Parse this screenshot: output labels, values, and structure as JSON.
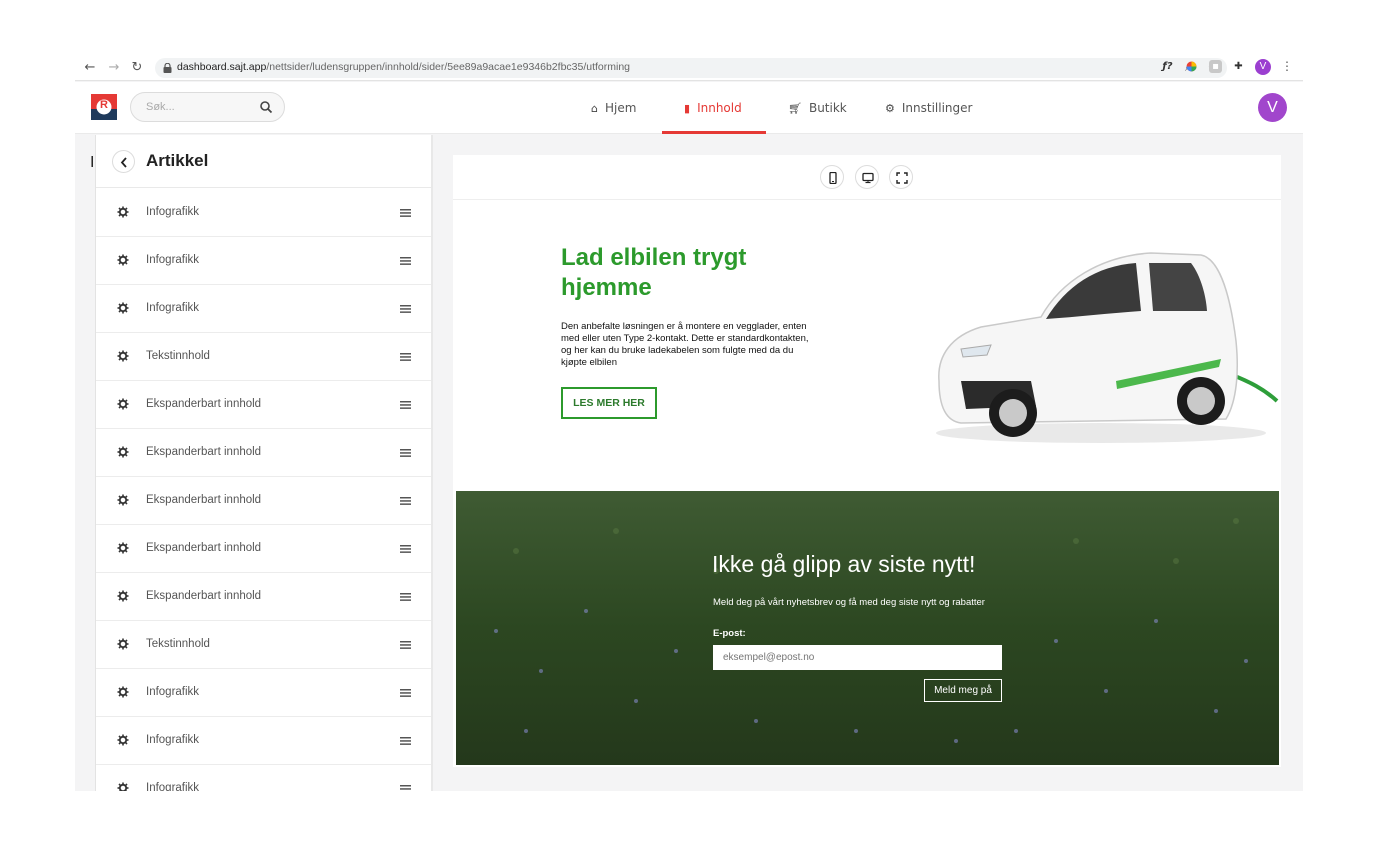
{
  "browser": {
    "url_domain": "dashboard.sajt.app",
    "url_path": "/nettsider/ludensgruppen/innhold/sider/5ee89a9acae1e9346b2fbc35/utforming",
    "profile_initial": "V",
    "extension_icons": [
      "zoom-icon",
      "star-icon",
      "function-icon",
      "color-wheel-icon",
      "extension-box-icon",
      "puzzle-icon"
    ]
  },
  "app": {
    "logo_letter": "R",
    "search_placeholder": "Søk...",
    "nav": [
      {
        "label": "Hjem",
        "icon": "home-icon"
      },
      {
        "label": "Innhold",
        "icon": "pages-icon",
        "active": true
      },
      {
        "label": "Butikk",
        "icon": "cart-icon"
      },
      {
        "label": "Innstillinger",
        "icon": "gear-icon"
      }
    ],
    "avatar_initial": "V",
    "accent_color": "#e53935",
    "avatar_color": "#a146cc"
  },
  "sidebar": {
    "edge_letter": "I",
    "title": "Artikkel",
    "items": [
      {
        "label": "Infografikk"
      },
      {
        "label": "Infografikk"
      },
      {
        "label": "Infografikk"
      },
      {
        "label": "Tekstinnhold"
      },
      {
        "label": "Ekspanderbart innhold"
      },
      {
        "label": "Ekspanderbart innhold"
      },
      {
        "label": "Ekspanderbart innhold"
      },
      {
        "label": "Ekspanderbart innhold"
      },
      {
        "label": "Ekspanderbart innhold"
      },
      {
        "label": "Tekstinnhold"
      },
      {
        "label": "Infografikk"
      },
      {
        "label": "Infografikk"
      },
      {
        "label": "Infografikk"
      }
    ]
  },
  "preview": {
    "device_buttons": [
      "mobile-icon",
      "desktop-icon",
      "fullscreen-icon"
    ],
    "hero": {
      "title": "Lad elbilen trygt hjemme",
      "text": "Den anbefalte løsningen er å montere en vegglader, enten med eller uten Type 2-kontakt. Dette er standardkontakten, og her kan du bruke ladekabelen som fulgte med da du kjøpte elbilen",
      "button": "LES MER HER",
      "brand_color": "#2c9a2c"
    },
    "newsletter": {
      "title": "Ikke gå glipp av siste nytt!",
      "subtitle": "Meld deg på vårt nyhetsbrev og få med deg siste nytt og rabatter",
      "email_label": "E-post:",
      "email_placeholder": "eksempel@epost.no",
      "button": "Meld meg på"
    }
  }
}
